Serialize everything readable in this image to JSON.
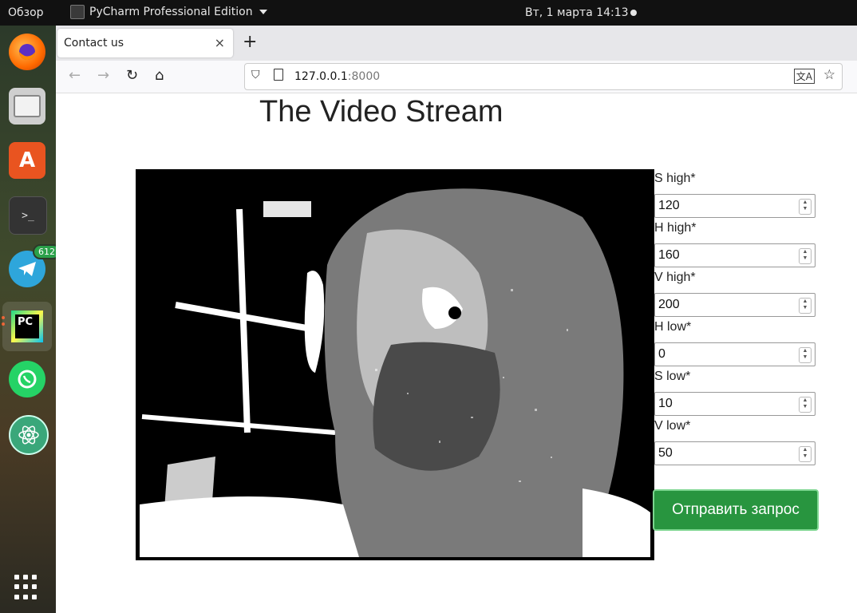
{
  "topbar": {
    "overview": "Обзор",
    "app_name": "PyCharm Professional Edition",
    "clock": "Вт, 1 марта  14:13"
  },
  "dock": {
    "telegram_badge": "612",
    "items": [
      "firefox-icon",
      "files-icon",
      "app-store-icon",
      "terminal-icon",
      "telegram-icon",
      "pycharm-icon",
      "whatsapp-icon",
      "atom-icon",
      "show-apps-icon"
    ]
  },
  "browser": {
    "tab_title": "Contact us",
    "url_host": "127.0.0.1",
    "url_port": ":8000"
  },
  "page": {
    "title": "The Video Stream",
    "fields": [
      {
        "label": "S high*",
        "value": "120"
      },
      {
        "label": "H high*",
        "value": "160"
      },
      {
        "label": "V high*",
        "value": "200"
      },
      {
        "label": "H low*",
        "value": "0"
      },
      {
        "label": "S low*",
        "value": "10"
      },
      {
        "label": "V low*",
        "value": "50"
      }
    ],
    "submit_label": "Отправить запрос"
  },
  "colors": {
    "submit_bg": "#28953f",
    "badge_bg": "#2ba14a"
  }
}
